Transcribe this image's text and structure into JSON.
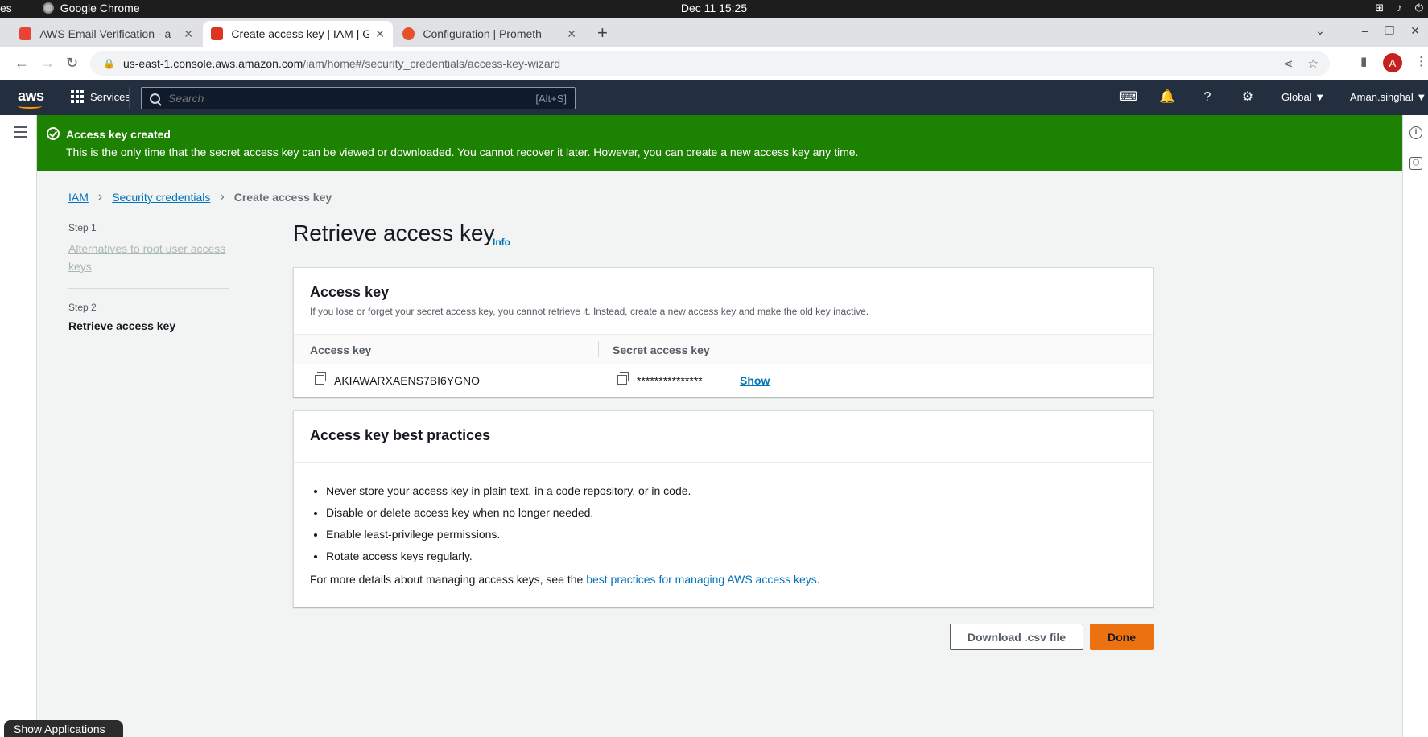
{
  "os": {
    "app_name": "Google Chrome",
    "left_fragment": "es",
    "datetime": "Dec 11  15:25",
    "show_applications": "Show Applications"
  },
  "browser": {
    "tabs": [
      {
        "title": "AWS Email Verification - a",
        "favicon_color": "#ea4335"
      },
      {
        "title": "Create access key | IAM | G",
        "favicon_color": "#dd3522"
      },
      {
        "title": "Configuration | Prometh",
        "favicon_color": "#e6522c"
      }
    ],
    "url_host": "us-east-1.console.aws.amazon.com",
    "url_path": "/iam/home#/security_credentials/access-key-wizard",
    "profile_initial": "A"
  },
  "aws_nav": {
    "logo": "aws",
    "services": "Services",
    "search_placeholder": "Search",
    "search_shortcut": "[Alt+S]",
    "region": "Global ▼",
    "account": "Aman.singhal ▼"
  },
  "flash": {
    "title": "Access key created",
    "message": "This is the only time that the secret access key can be viewed or downloaded. You cannot recover it later. However, you can create a new access key any time."
  },
  "breadcrumb": {
    "items": [
      "IAM",
      "Security credentials"
    ],
    "current": "Create access key"
  },
  "steps": {
    "step1_label": "Step 1",
    "step1_title": "Alternatives to root user access keys",
    "step2_label": "Step 2",
    "step2_title": "Retrieve access key"
  },
  "page": {
    "title": "Retrieve access key",
    "info": "Info"
  },
  "access_key_card": {
    "title": "Access key",
    "description": "If you lose or forget your secret access key, you cannot retrieve it. Instead, create a new access key and make the old key inactive.",
    "col_access_key": "Access key",
    "col_secret": "Secret access key",
    "access_key_value": "AKIAWARXAENS7BI6YGNO",
    "secret_masked": "***************",
    "show_label": "Show"
  },
  "best_practices": {
    "title": "Access key best practices",
    "items": [
      "Never store your access key in plain text, in a code repository, or in code.",
      "Disable or delete access key when no longer needed.",
      "Enable least-privilege permissions.",
      "Rotate access keys regularly."
    ],
    "more_prefix": "For more details about managing access keys, see the ",
    "more_link": "best practices for managing AWS access keys",
    "more_suffix": "."
  },
  "buttons": {
    "download": "Download .csv file",
    "done": "Done"
  },
  "colors": {
    "success": "#1d8102",
    "link": "#0073bb",
    "primary": "#ec7211",
    "nav_bg": "#232f3e"
  }
}
